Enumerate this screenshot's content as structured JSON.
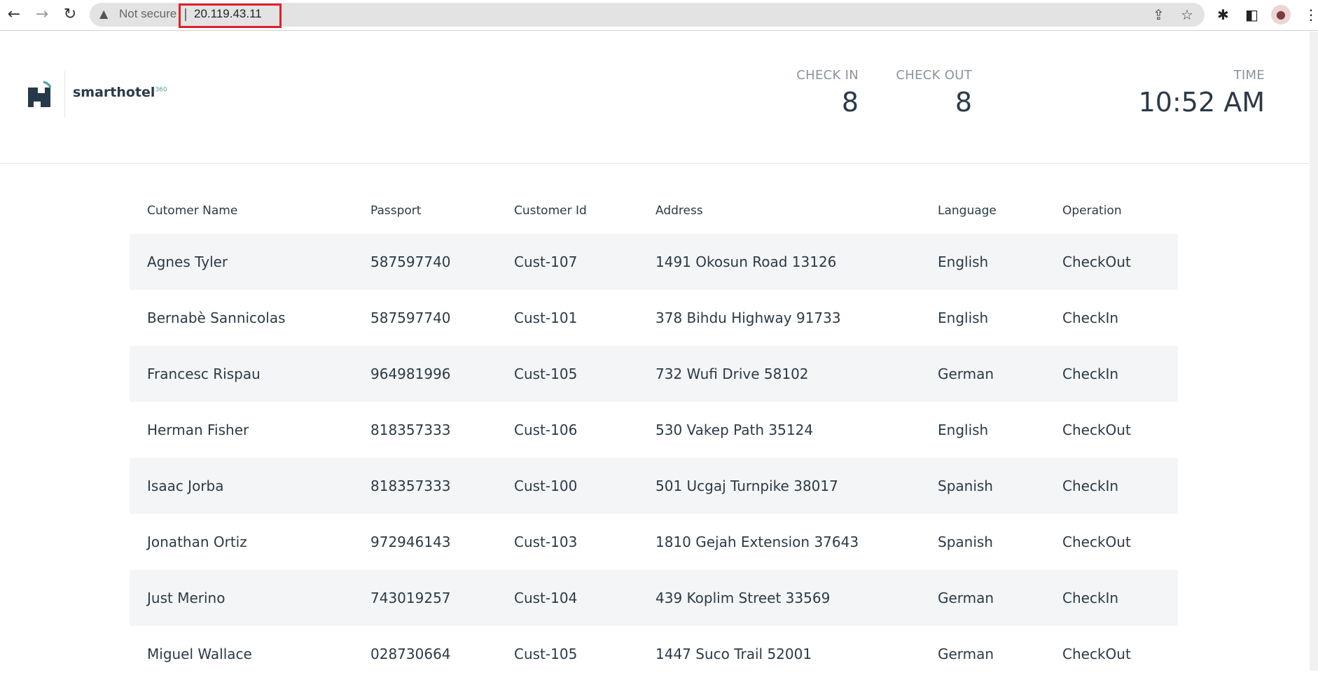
{
  "browser": {
    "security": "Not secure",
    "url": "20.119.43.11"
  },
  "brand": {
    "name": "smarthotel",
    "sup": "360"
  },
  "stats": {
    "checkin_label": "CHECK IN",
    "checkin_value": "8",
    "checkout_label": "CHECK OUT",
    "checkout_value": "8",
    "time_label": "TIME",
    "time_value": "10:52 AM"
  },
  "table": {
    "headers": [
      "Cutomer Name",
      "Passport",
      "Customer Id",
      "Address",
      "Language",
      "Operation"
    ],
    "rows": [
      [
        "Agnes Tyler",
        "587597740",
        "Cust-107",
        "1491 Okosun Road 13126",
        "English",
        "CheckOut"
      ],
      [
        "Bernabè Sannicolas",
        "587597740",
        "Cust-101",
        "378 Bihdu Highway 91733",
        "English",
        "CheckIn"
      ],
      [
        "Francesc Rispau",
        "964981996",
        "Cust-105",
        "732 Wufi Drive 58102",
        "German",
        "CheckIn"
      ],
      [
        "Herman Fisher",
        "818357333",
        "Cust-106",
        "530 Vakep Path 35124",
        "English",
        "CheckOut"
      ],
      [
        "Isaac Jorba",
        "818357333",
        "Cust-100",
        "501 Ucgaj Turnpike 38017",
        "Spanish",
        "CheckIn"
      ],
      [
        "Jonathan Ortiz",
        "972946143",
        "Cust-103",
        "1810 Gejah Extension 37643",
        "Spanish",
        "CheckOut"
      ],
      [
        "Just Merino",
        "743019257",
        "Cust-104",
        "439 Koplim Street 33569",
        "German",
        "CheckIn"
      ],
      [
        "Miguel Wallace",
        "028730664",
        "Cust-105",
        "1447 Suco Trail 52001",
        "German",
        "CheckOut"
      ]
    ]
  }
}
